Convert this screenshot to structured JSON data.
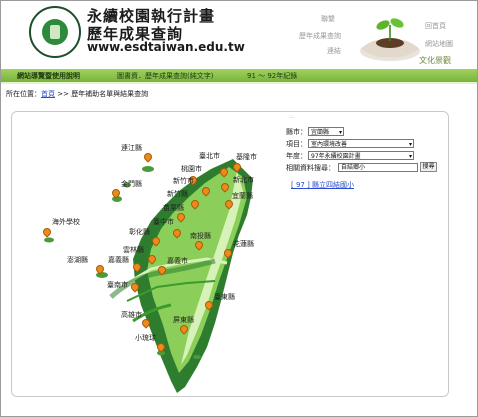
{
  "header": {
    "title": "永續校園執行計畫",
    "subtitle": "歷年成果查詢",
    "url": "www.esdtaiwan.edu.tw",
    "nav_links": [
      "聯繫",
      "歷年成果查詢",
      "連結",
      "回首頁",
      "網站地圖",
      "文化景觀"
    ]
  },
  "menubar": {
    "items": [
      "網站導覽暨使用說明",
      "圖書資．歷年成果查詢(純文字)",
      "91 ～ 92年紀錄"
    ]
  },
  "breadcrumb": {
    "prefix": "所在位置：",
    "home": "首頁",
    "separator": " >> ",
    "current": "歷年補助名單與結果查詢"
  },
  "map": {
    "labels": [
      "連江縣",
      "金門縣",
      "海外學校",
      "澎湖縣",
      "臺北市",
      "基隆市",
      "桃園市",
      "新竹市",
      "新北市",
      "新竹縣",
      "苗栗縣",
      "宜蘭縣",
      "臺中市",
      "彰化縣",
      "南投縣",
      "雲林縣",
      "花蓮縣",
      "嘉義縣",
      "嘉義市",
      "臺南市",
      "臺東縣",
      "高雄市",
      "屏東縣",
      "小琉球"
    ]
  },
  "search": {
    "county_label": "縣市：",
    "county_value": "宜蘭縣",
    "item_label": "項目：",
    "item_value": "室內環境改善",
    "year_label": "年度：",
    "year_value": "97年永續校園計畫",
    "keyword_label": "相關資料搜尋：",
    "keyword_value": "自結鄉小",
    "search_button": "搜尋",
    "result_link": "[ 97 ] 縣立四結國小"
  },
  "colors": {
    "accent_green": "#79b43a",
    "map_green": "#2e7d2e",
    "pin_orange": "#ee8a1a",
    "link_blue": "#2a4ad0"
  }
}
